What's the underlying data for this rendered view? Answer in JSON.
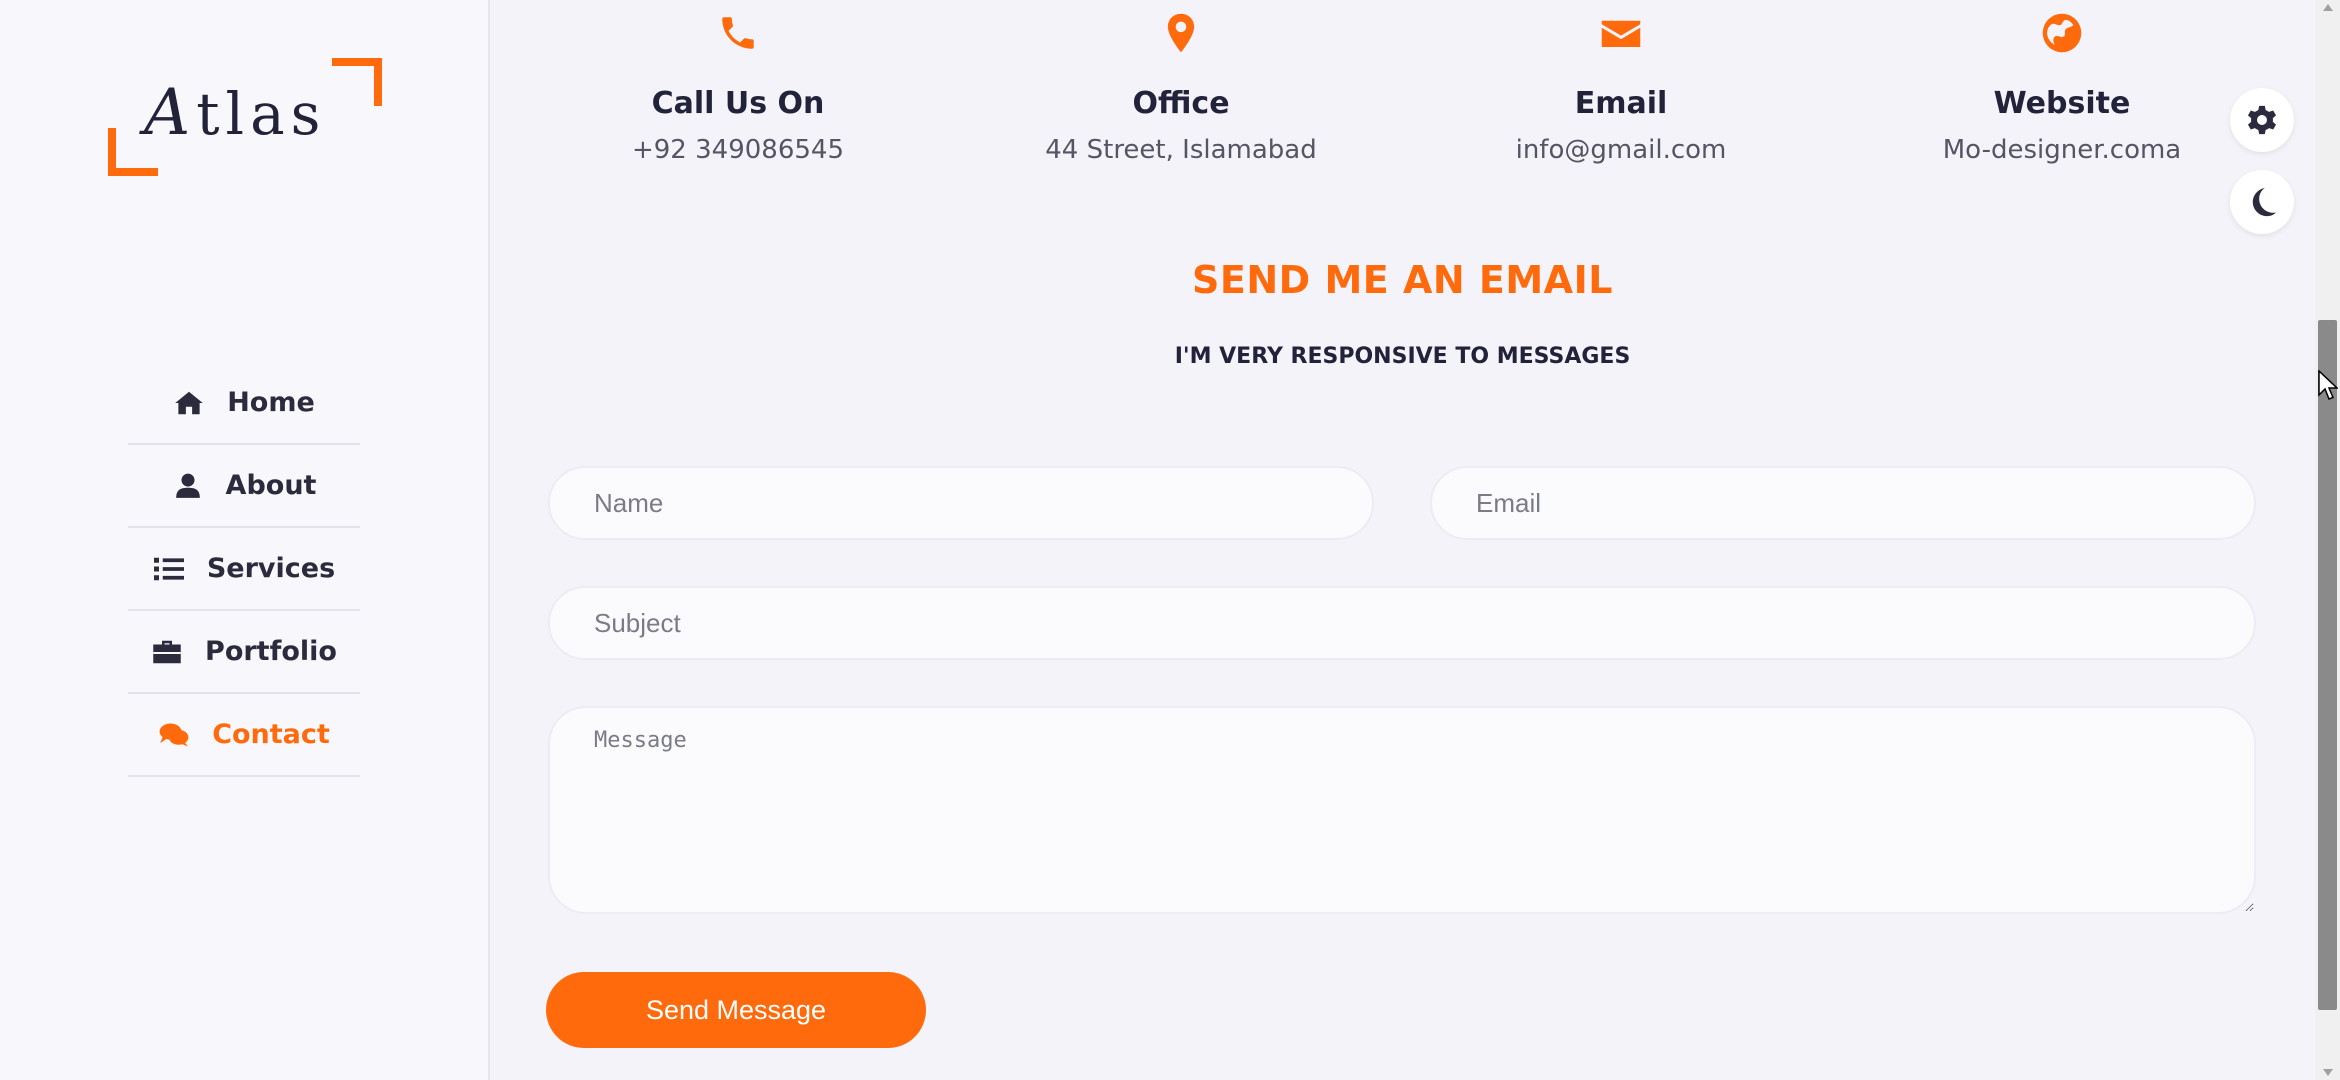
{
  "brand": {
    "logo_first": "A",
    "logo_rest": "tlas",
    "accent": "#ff6a0d"
  },
  "nav": {
    "items": [
      {
        "label": "Home",
        "icon": "home-icon"
      },
      {
        "label": "About",
        "icon": "user-icon"
      },
      {
        "label": "Services",
        "icon": "list-icon"
      },
      {
        "label": "Portfolio",
        "icon": "briefcase-icon"
      },
      {
        "label": "Contact",
        "icon": "chat-icon",
        "active": true
      }
    ]
  },
  "contact_info": [
    {
      "icon": "phone-icon",
      "title": "Call Us On",
      "value": "+92 349086545"
    },
    {
      "icon": "map-pin-icon",
      "title": "Office",
      "value": "44 Street, Islamabad"
    },
    {
      "icon": "envelope-icon",
      "title": "Email",
      "value": "info@gmail.com"
    },
    {
      "icon": "globe-icon",
      "title": "Website",
      "value": "Mo-designer.coma"
    }
  ],
  "form": {
    "heading": "SEND ME AN EMAIL",
    "subheading": "I'M VERY RESPONSIVE TO MESSAGES",
    "name_placeholder": "Name",
    "email_placeholder": "Email",
    "subject_placeholder": "Subject",
    "message_placeholder": "Message",
    "submit_label": "Send Message"
  },
  "floating": {
    "settings_icon": "gear-icon",
    "theme_icon": "moon-icon"
  }
}
